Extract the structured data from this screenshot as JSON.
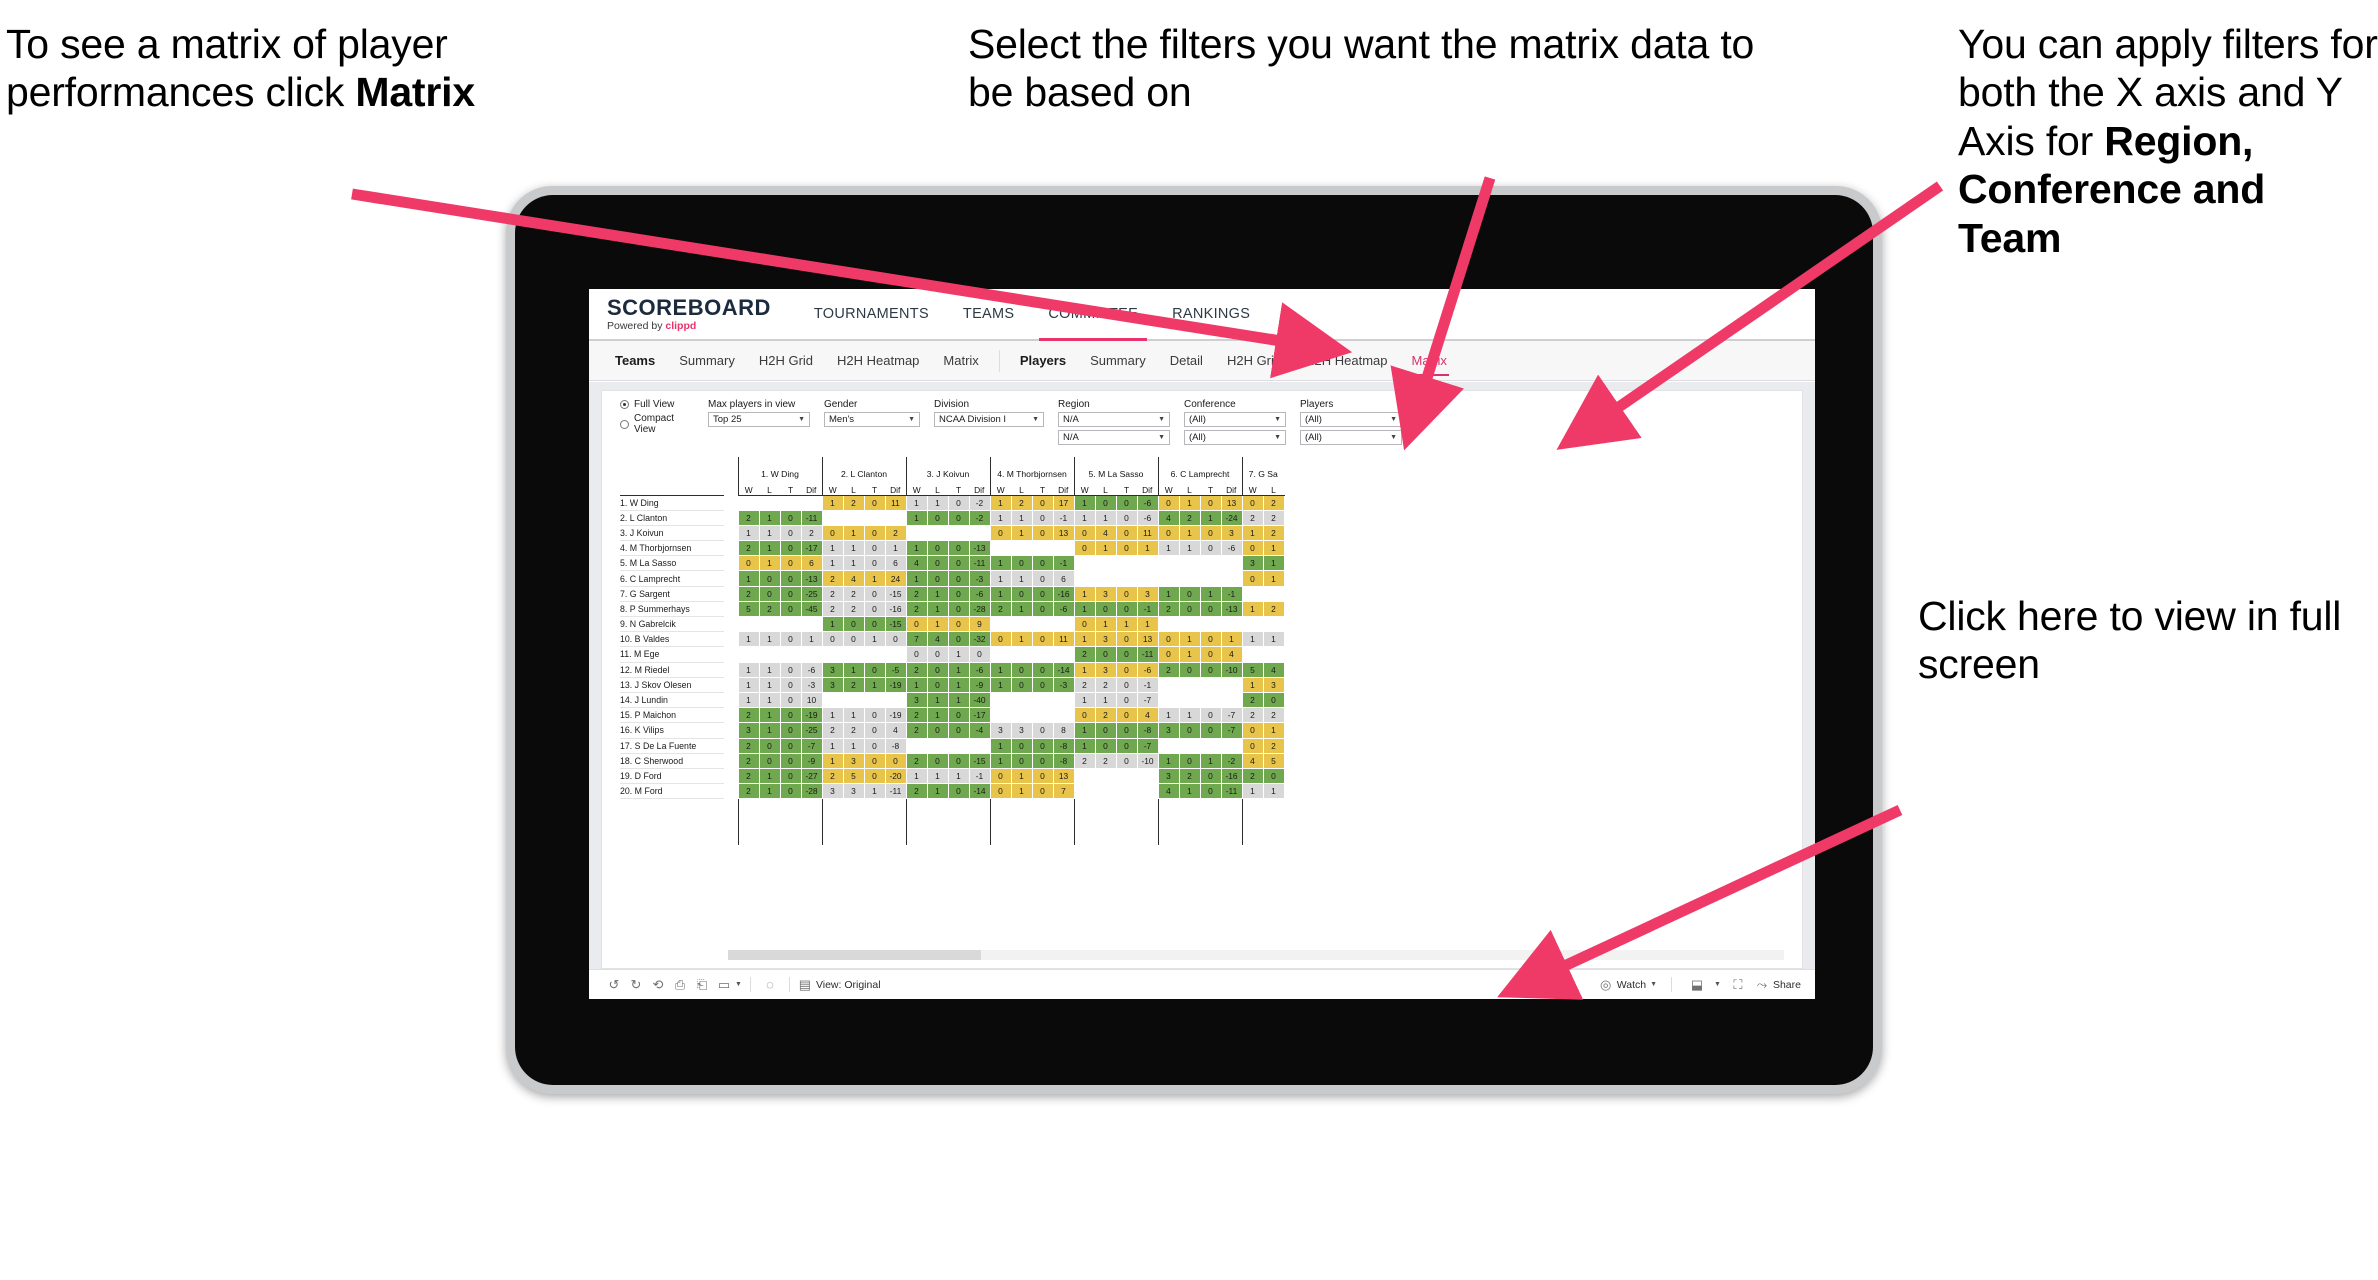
{
  "annotations": {
    "matrix_hint": {
      "pre": "To see a matrix of player performances click ",
      "bold": "Matrix"
    },
    "filters_hint": "Select the filters you want the matrix data to be based on",
    "axis_hint": {
      "pre": "You  can apply filters for both the X axis and Y Axis for ",
      "bold": "Region, Conference and Team"
    },
    "fullscreen_hint": "Click here to view in full screen"
  },
  "brand": {
    "name": "SCOREBOARD",
    "powered_pre": "Powered by ",
    "powered_brand": "clippd",
    "accent": "#e8336d"
  },
  "topnav": {
    "items": [
      "TOURNAMENTS",
      "TEAMS",
      "COMMITTEE",
      "RANKINGS"
    ],
    "active": "COMMITTEE"
  },
  "subnav": {
    "group_teams": {
      "title": "Teams",
      "tabs": [
        "Summary",
        "H2H Grid",
        "H2H Heatmap",
        "Matrix"
      ]
    },
    "group_players": {
      "title": "Players",
      "tabs": [
        "Summary",
        "Detail",
        "H2H Grid",
        "H2H Heatmap",
        "Matrix"
      ],
      "selected": "Matrix"
    }
  },
  "filters": {
    "view_mode": {
      "full": "Full View",
      "compact": "Compact View",
      "selected": "Full View"
    },
    "max_players": {
      "label": "Max players in view",
      "value": "Top 25"
    },
    "gender": {
      "label": "Gender",
      "value": "Men's"
    },
    "division": {
      "label": "Division",
      "value": "NCAA Division I"
    },
    "region": {
      "label": "Region",
      "value_x": "N/A",
      "value_y": "N/A"
    },
    "conference": {
      "label": "Conference",
      "value_x": "(All)",
      "value_y": "(All)"
    },
    "players": {
      "label": "Players",
      "value_x": "(All)",
      "value_y": "(All)"
    }
  },
  "matrix": {
    "sub_headers": [
      "W",
      "L",
      "T",
      "Dif"
    ],
    "col_players": [
      "1. W Ding",
      "2. L Clanton",
      "3. J Koivun",
      "4. M Thorbjornsen",
      "5. M La Sasso",
      "6. C Lamprecht",
      "7. G Sa"
    ],
    "row_players": [
      "1. W Ding",
      "2. L Clanton",
      "3. J Koivun",
      "4. M Thorbjornsen",
      "5. M La Sasso",
      "6. C Lamprecht",
      "7. G Sargent",
      "8. P Summerhays",
      "9. N Gabrelcik",
      "10. B Valdes",
      "11. M Ege",
      "12. M Riedel",
      "13. J Skov Olesen",
      "14. J Lundin",
      "15. P Maichon",
      "16. K Vilips",
      "17. S De La Fuente",
      "18. C Sherwood",
      "19. D Ford",
      "20. M Ford"
    ],
    "colors": {
      "green": "#6fa84f",
      "gray": "#d8d8d8",
      "gold": "#e9c44a",
      "empty": "#ffffff"
    },
    "cells": [
      [
        {
          "v": null
        },
        {
          "v": [
            "1",
            "2",
            "0",
            "11"
          ],
          "c": "gold"
        },
        {
          "v": [
            "1",
            "1",
            "0",
            "-2"
          ],
          "c": "gray"
        },
        {
          "v": [
            "1",
            "2",
            "0",
            "17"
          ],
          "c": "gold"
        },
        {
          "v": [
            "1",
            "0",
            "0",
            "-6"
          ],
          "c": "green"
        },
        {
          "v": [
            "0",
            "1",
            "0",
            "13"
          ],
          "c": "gold"
        },
        {
          "v": [
            "0",
            "2"
          ],
          "c": "gold"
        }
      ],
      [
        {
          "v": [
            "2",
            "1",
            "0",
            "-11"
          ],
          "c": "green"
        },
        {
          "v": null
        },
        {
          "v": [
            "1",
            "0",
            "0",
            "-2"
          ],
          "c": "green"
        },
        {
          "v": [
            "1",
            "1",
            "0",
            "-1"
          ],
          "c": "gray"
        },
        {
          "v": [
            "1",
            "1",
            "0",
            "-6"
          ],
          "c": "gray"
        },
        {
          "v": [
            "4",
            "2",
            "1",
            "-24"
          ],
          "c": "green"
        },
        {
          "v": [
            "2",
            "2"
          ],
          "c": "gray"
        }
      ],
      [
        {
          "v": [
            "1",
            "1",
            "0",
            "2"
          ],
          "c": "gray"
        },
        {
          "v": [
            "0",
            "1",
            "0",
            "2"
          ],
          "c": "gold"
        },
        {
          "v": null
        },
        {
          "v": [
            "0",
            "1",
            "0",
            "13"
          ],
          "c": "gold"
        },
        {
          "v": [
            "0",
            "4",
            "0",
            "11"
          ],
          "c": "gold"
        },
        {
          "v": [
            "0",
            "1",
            "0",
            "3"
          ],
          "c": "gold"
        },
        {
          "v": [
            "1",
            "2"
          ],
          "c": "gold"
        }
      ],
      [
        {
          "v": [
            "2",
            "1",
            "0",
            "-17"
          ],
          "c": "green"
        },
        {
          "v": [
            "1",
            "1",
            "0",
            "1"
          ],
          "c": "gray"
        },
        {
          "v": [
            "1",
            "0",
            "0",
            "-13"
          ],
          "c": "green"
        },
        {
          "v": null
        },
        {
          "v": [
            "0",
            "1",
            "0",
            "1"
          ],
          "c": "gold"
        },
        {
          "v": [
            "1",
            "1",
            "0",
            "-6"
          ],
          "c": "gray"
        },
        {
          "v": [
            "0",
            "1"
          ],
          "c": "gold"
        }
      ],
      [
        {
          "v": [
            "0",
            "1",
            "0",
            "6"
          ],
          "c": "gold"
        },
        {
          "v": [
            "1",
            "1",
            "0",
            "6"
          ],
          "c": "gray"
        },
        {
          "v": [
            "4",
            "0",
            "0",
            "-11"
          ],
          "c": "green"
        },
        {
          "v": [
            "1",
            "0",
            "0",
            "-1"
          ],
          "c": "green"
        },
        {
          "v": null
        },
        {
          "v": null
        },
        {
          "v": [
            "3",
            "1"
          ],
          "c": "green"
        }
      ],
      [
        {
          "v": [
            "1",
            "0",
            "0",
            "-13"
          ],
          "c": "green"
        },
        {
          "v": [
            "2",
            "4",
            "1",
            "24"
          ],
          "c": "gold"
        },
        {
          "v": [
            "1",
            "0",
            "0",
            "-3"
          ],
          "c": "green"
        },
        {
          "v": [
            "1",
            "1",
            "0",
            "6"
          ],
          "c": "gray"
        },
        {
          "v": null
        },
        {
          "v": null
        },
        {
          "v": [
            "0",
            "1"
          ],
          "c": "gold"
        }
      ],
      [
        {
          "v": [
            "2",
            "0",
            "0",
            "-25"
          ],
          "c": "green"
        },
        {
          "v": [
            "2",
            "2",
            "0",
            "-15"
          ],
          "c": "gray"
        },
        {
          "v": [
            "2",
            "1",
            "0",
            "-6"
          ],
          "c": "green"
        },
        {
          "v": [
            "1",
            "0",
            "0",
            "-16"
          ],
          "c": "green"
        },
        {
          "v": [
            "1",
            "3",
            "0",
            "3"
          ],
          "c": "gold"
        },
        {
          "v": [
            "1",
            "0",
            "1",
            "-1"
          ],
          "c": "green"
        },
        {
          "v": null
        }
      ],
      [
        {
          "v": [
            "5",
            "2",
            "0",
            "-45"
          ],
          "c": "green"
        },
        {
          "v": [
            "2",
            "2",
            "0",
            "-16"
          ],
          "c": "gray"
        },
        {
          "v": [
            "2",
            "1",
            "0",
            "-28"
          ],
          "c": "green"
        },
        {
          "v": [
            "2",
            "1",
            "0",
            "-6"
          ],
          "c": "green"
        },
        {
          "v": [
            "1",
            "0",
            "0",
            "-1"
          ],
          "c": "green"
        },
        {
          "v": [
            "2",
            "0",
            "0",
            "-13"
          ],
          "c": "green"
        },
        {
          "v": [
            "1",
            "2"
          ],
          "c": "gold"
        }
      ],
      [
        {
          "v": null
        },
        {
          "v": [
            "1",
            "0",
            "0",
            "-15"
          ],
          "c": "green"
        },
        {
          "v": [
            "0",
            "1",
            "0",
            "9"
          ],
          "c": "gold"
        },
        {
          "v": null
        },
        {
          "v": [
            "0",
            "1",
            "1",
            "1"
          ],
          "c": "gold"
        },
        {
          "v": null
        },
        {
          "v": null
        }
      ],
      [
        {
          "v": [
            "1",
            "1",
            "0",
            "1"
          ],
          "c": "gray"
        },
        {
          "v": [
            "0",
            "0",
            "1",
            "0"
          ],
          "c": "gray"
        },
        {
          "v": [
            "7",
            "4",
            "0",
            "-32"
          ],
          "c": "green"
        },
        {
          "v": [
            "0",
            "1",
            "0",
            "11"
          ],
          "c": "gold"
        },
        {
          "v": [
            "1",
            "3",
            "0",
            "13"
          ],
          "c": "gold"
        },
        {
          "v": [
            "0",
            "1",
            "0",
            "1"
          ],
          "c": "gold"
        },
        {
          "v": [
            "1",
            "1"
          ],
          "c": "gray"
        }
      ],
      [
        {
          "v": null
        },
        {
          "v": null
        },
        {
          "v": [
            "0",
            "0",
            "1",
            "0"
          ],
          "c": "gray"
        },
        {
          "v": null
        },
        {
          "v": [
            "2",
            "0",
            "0",
            "-11"
          ],
          "c": "green"
        },
        {
          "v": [
            "0",
            "1",
            "0",
            "4"
          ],
          "c": "gold"
        },
        {
          "v": null
        }
      ],
      [
        {
          "v": [
            "1",
            "1",
            "0",
            "-6"
          ],
          "c": "gray"
        },
        {
          "v": [
            "3",
            "1",
            "0",
            "-5"
          ],
          "c": "green"
        },
        {
          "v": [
            "2",
            "0",
            "1",
            "-6"
          ],
          "c": "green"
        },
        {
          "v": [
            "1",
            "0",
            "0",
            "-14"
          ],
          "c": "green"
        },
        {
          "v": [
            "1",
            "3",
            "0",
            "-6"
          ],
          "c": "gold"
        },
        {
          "v": [
            "2",
            "0",
            "0",
            "-10"
          ],
          "c": "green"
        },
        {
          "v": [
            "5",
            "4"
          ],
          "c": "green"
        }
      ],
      [
        {
          "v": [
            "1",
            "1",
            "0",
            "-3"
          ],
          "c": "gray"
        },
        {
          "v": [
            "3",
            "2",
            "1",
            "-19"
          ],
          "c": "green"
        },
        {
          "v": [
            "1",
            "0",
            "1",
            "-9"
          ],
          "c": "green"
        },
        {
          "v": [
            "1",
            "0",
            "0",
            "-3"
          ],
          "c": "green"
        },
        {
          "v": [
            "2",
            "2",
            "0",
            "-1"
          ],
          "c": "gray"
        },
        {
          "v": null
        },
        {
          "v": [
            "1",
            "3"
          ],
          "c": "gold"
        }
      ],
      [
        {
          "v": [
            "1",
            "1",
            "0",
            "10"
          ],
          "c": "gray"
        },
        {
          "v": null
        },
        {
          "v": [
            "3",
            "1",
            "1",
            "-40"
          ],
          "c": "green"
        },
        {
          "v": null
        },
        {
          "v": [
            "1",
            "1",
            "0",
            "-7"
          ],
          "c": "gray"
        },
        {
          "v": null
        },
        {
          "v": [
            "2",
            "0"
          ],
          "c": "green"
        }
      ],
      [
        {
          "v": [
            "2",
            "1",
            "0",
            "-19"
          ],
          "c": "green"
        },
        {
          "v": [
            "1",
            "1",
            "0",
            "-19"
          ],
          "c": "gray"
        },
        {
          "v": [
            "2",
            "1",
            "0",
            "-17"
          ],
          "c": "green"
        },
        {
          "v": null
        },
        {
          "v": [
            "0",
            "2",
            "0",
            "4"
          ],
          "c": "gold"
        },
        {
          "v": [
            "1",
            "1",
            "0",
            "-7"
          ],
          "c": "gray"
        },
        {
          "v": [
            "2",
            "2"
          ],
          "c": "gray"
        }
      ],
      [
        {
          "v": [
            "3",
            "1",
            "0",
            "-25"
          ],
          "c": "green"
        },
        {
          "v": [
            "2",
            "2",
            "0",
            "4"
          ],
          "c": "gray"
        },
        {
          "v": [
            "2",
            "0",
            "0",
            "-4"
          ],
          "c": "green"
        },
        {
          "v": [
            "3",
            "3",
            "0",
            "8"
          ],
          "c": "gray"
        },
        {
          "v": [
            "1",
            "0",
            "0",
            "-8"
          ],
          "c": "green"
        },
        {
          "v": [
            "3",
            "0",
            "0",
            "-7"
          ],
          "c": "green"
        },
        {
          "v": [
            "0",
            "1"
          ],
          "c": "gold"
        }
      ],
      [
        {
          "v": [
            "2",
            "0",
            "0",
            "-7"
          ],
          "c": "green"
        },
        {
          "v": [
            "1",
            "1",
            "0",
            "-8"
          ],
          "c": "gray"
        },
        {
          "v": null
        },
        {
          "v": [
            "1",
            "0",
            "0",
            "-8"
          ],
          "c": "green"
        },
        {
          "v": [
            "1",
            "0",
            "0",
            "-7"
          ],
          "c": "green"
        },
        {
          "v": null
        },
        {
          "v": [
            "0",
            "2"
          ],
          "c": "gold"
        }
      ],
      [
        {
          "v": [
            "2",
            "0",
            "0",
            "-9"
          ],
          "c": "green"
        },
        {
          "v": [
            "1",
            "3",
            "0",
            "0"
          ],
          "c": "gold"
        },
        {
          "v": [
            "2",
            "0",
            "0",
            "-15"
          ],
          "c": "green"
        },
        {
          "v": [
            "1",
            "0",
            "0",
            "-8"
          ],
          "c": "green"
        },
        {
          "v": [
            "2",
            "2",
            "0",
            "-10"
          ],
          "c": "gray"
        },
        {
          "v": [
            "1",
            "0",
            "1",
            "-2"
          ],
          "c": "green"
        },
        {
          "v": [
            "4",
            "5"
          ],
          "c": "gold"
        }
      ],
      [
        {
          "v": [
            "2",
            "1",
            "0",
            "-27"
          ],
          "c": "green"
        },
        {
          "v": [
            "2",
            "5",
            "0",
            "-20"
          ],
          "c": "gold"
        },
        {
          "v": [
            "1",
            "1",
            "1",
            "-1"
          ],
          "c": "gray"
        },
        {
          "v": [
            "0",
            "1",
            "0",
            "13"
          ],
          "c": "gold"
        },
        {
          "v": null
        },
        {
          "v": [
            "3",
            "2",
            "0",
            "-16"
          ],
          "c": "green"
        },
        {
          "v": [
            "2",
            "0"
          ],
          "c": "green"
        }
      ],
      [
        {
          "v": [
            "2",
            "1",
            "0",
            "-28"
          ],
          "c": "green"
        },
        {
          "v": [
            "3",
            "3",
            "1",
            "-11"
          ],
          "c": "gray"
        },
        {
          "v": [
            "2",
            "1",
            "0",
            "-14"
          ],
          "c": "green"
        },
        {
          "v": [
            "0",
            "1",
            "0",
            "7"
          ],
          "c": "gold"
        },
        {
          "v": null
        },
        {
          "v": [
            "4",
            "1",
            "0",
            "-11"
          ],
          "c": "green"
        },
        {
          "v": [
            "1",
            "1"
          ],
          "c": "gray"
        }
      ]
    ]
  },
  "toolbar": {
    "icons": [
      "undo-icon",
      "redo-icon",
      "revert-icon",
      "refresh-icon",
      "pause-icon",
      "shape-icon"
    ],
    "view_label": "View: Original",
    "watch_label": "Watch",
    "share_label": "Share"
  }
}
